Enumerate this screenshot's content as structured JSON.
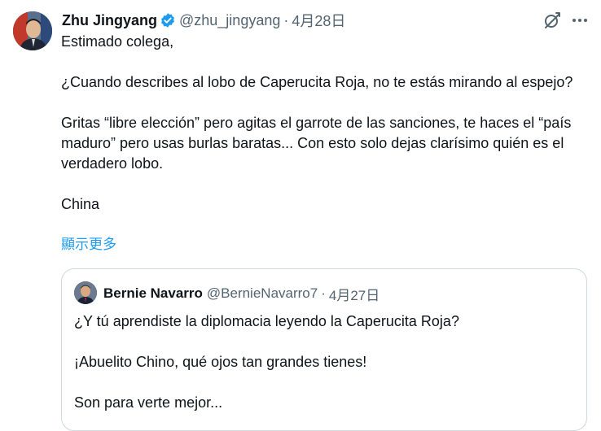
{
  "tweet": {
    "display_name": "Zhu Jingyang",
    "handle": "@zhu_jingyang",
    "separator": "·",
    "date": "4月28日",
    "lines": [
      "Estimado colega,",
      "¿Cuando describes al lobo de Caperucita Roja, no te estás mirando al espejo?",
      "Gritas “libre elección” pero agitas el garrote de las sanciones, te haces el “país maduro” pero usas burlas baratas... Con esto solo dejas clarísimo quién es el verdadero lobo.",
      "China"
    ],
    "show_more": "顯示更多"
  },
  "quote": {
    "display_name": "Bernie Navarro",
    "handle": "@BernieNavarro7",
    "separator": "·",
    "date": "4月27日",
    "lines": [
      "¿Y tú aprendiste la diplomacia leyendo la Caperucita Roja?",
      "¡Abuelito Chino, qué ojos tan grandes tienes!",
      "Son para verte mejor..."
    ]
  },
  "icons": {
    "verified": "verified-badge-icon",
    "grok": "grok-icon",
    "more": "more-options-icon"
  },
  "colors": {
    "link": "#1d9bf0",
    "verified": "#1d9bf0",
    "secondary_text": "#536471",
    "border": "#cfd9de"
  }
}
